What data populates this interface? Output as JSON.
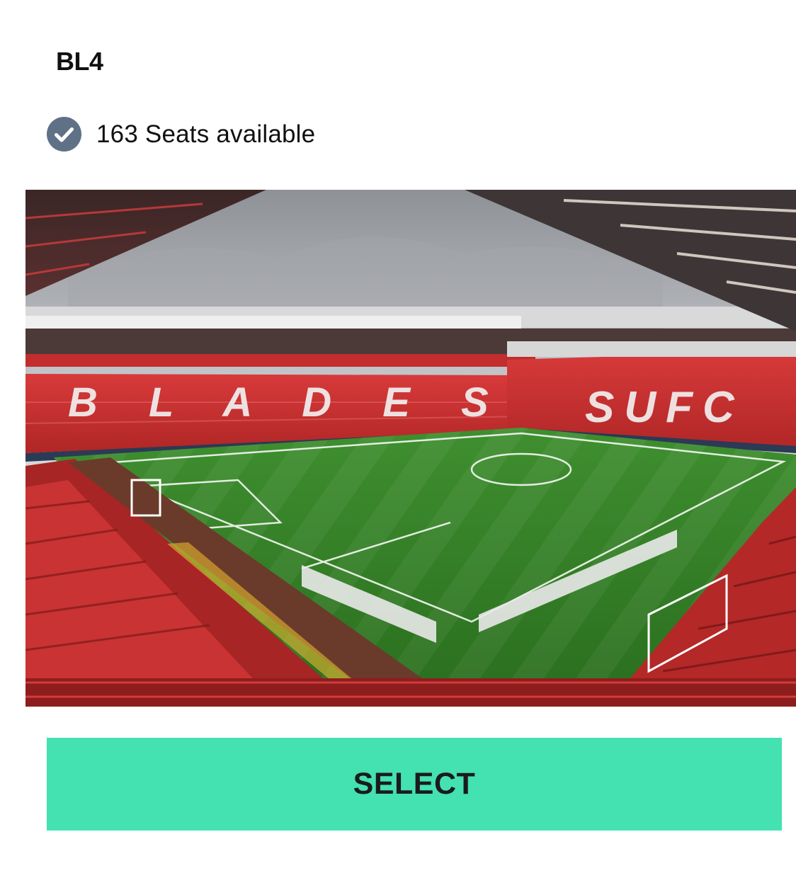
{
  "block": {
    "name": "BL4"
  },
  "availability": {
    "icon": "check-circle-icon",
    "text": "163 Seats available",
    "icon_color": "#5f7186"
  },
  "image": {
    "subject": "stadium-view-photo",
    "stand_lettering_left": "BLADES",
    "stand_lettering_right": "SUFC"
  },
  "action": {
    "select_label": "SELECT",
    "button_color": "#43e2b0"
  }
}
